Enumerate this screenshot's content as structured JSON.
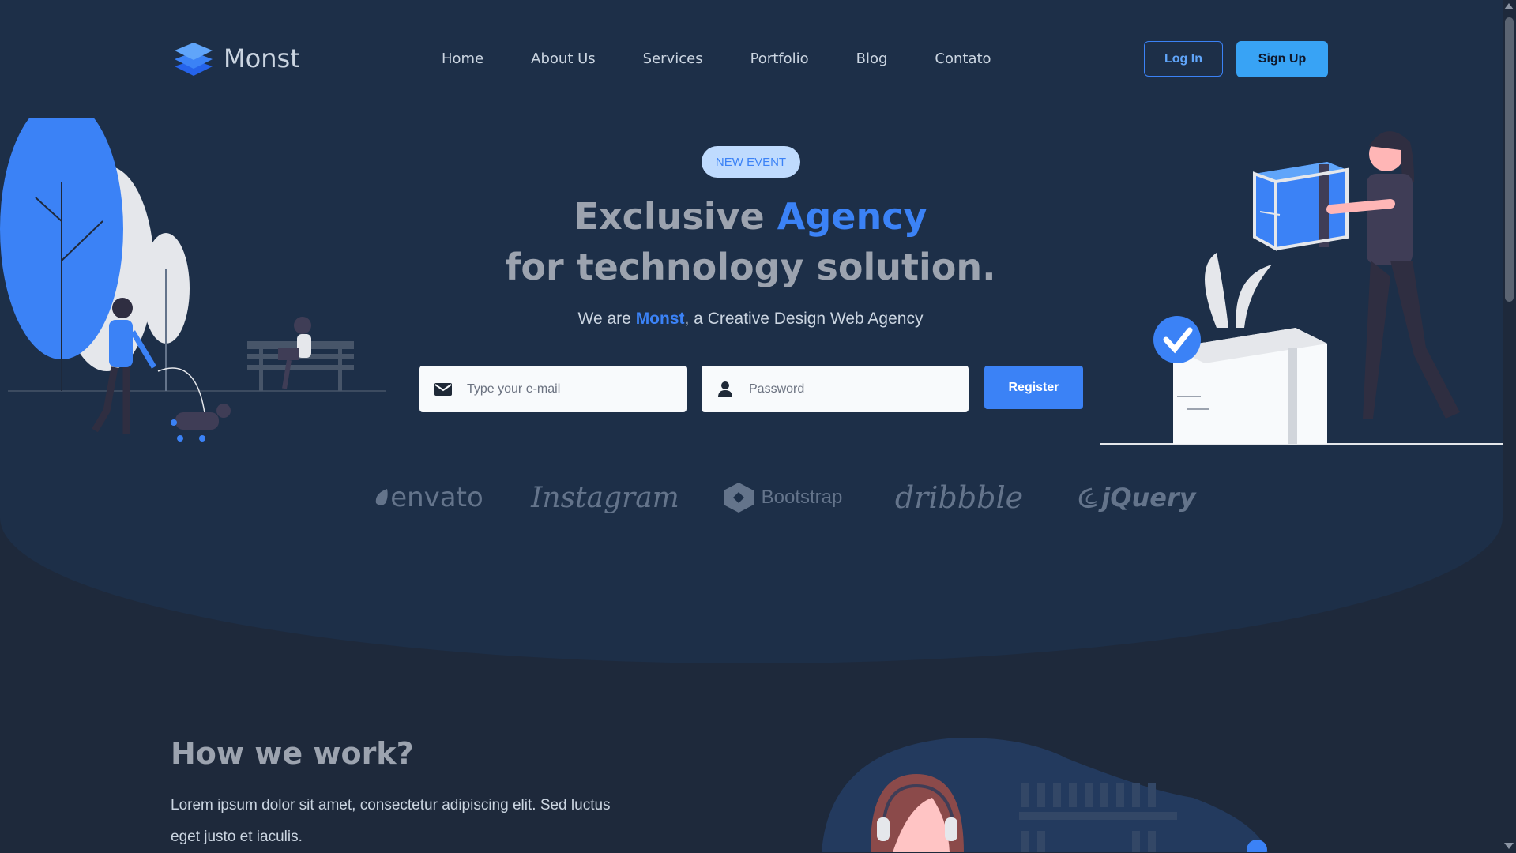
{
  "brand": {
    "name": "Monst"
  },
  "nav": [
    {
      "label": "Home"
    },
    {
      "label": "About Us"
    },
    {
      "label": "Services"
    },
    {
      "label": "Portfolio"
    },
    {
      "label": "Blog"
    },
    {
      "label": "Contato"
    }
  ],
  "auth": {
    "login_label": "Log In",
    "signup_label": "Sign Up"
  },
  "hero": {
    "badge": "NEW EVENT",
    "headline_part1": "Exclusive ",
    "headline_accent": "Agency",
    "headline_line2": "for technology solution.",
    "tagline_prefix": "We are ",
    "tagline_brand": "Monst",
    "tagline_suffix": ", a Creative Design Web Agency",
    "email_placeholder": "Type your e-mail",
    "password_placeholder": "Password",
    "register_label": "Register"
  },
  "partners": [
    "envato",
    "Instagram",
    "Bootstrap",
    "dribbble",
    "jQuery"
  ],
  "how": {
    "title": "How we work?",
    "text": "Lorem ipsum dolor sit amet, consectetur adipiscing elit. Sed luctus eget justo et iaculis."
  },
  "colors": {
    "accent": "#3b82f6",
    "background": "#1e293b",
    "hero_background": "#1d2f48"
  }
}
